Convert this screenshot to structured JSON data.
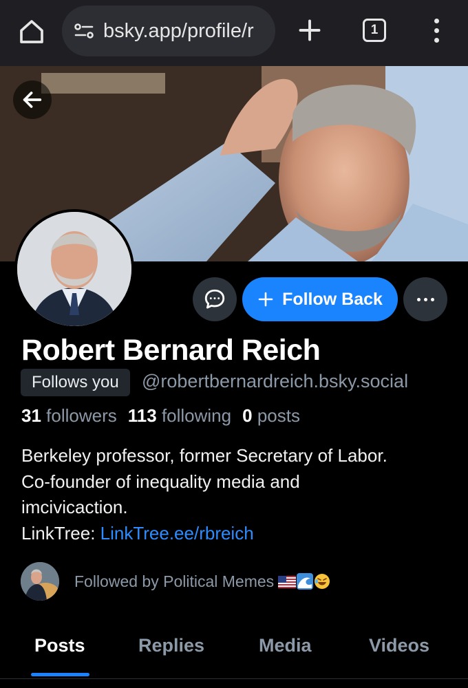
{
  "browser": {
    "url": "bsky.app/profile/r",
    "tab_count": "1",
    "icons": [
      "home-icon",
      "site-settings-icon",
      "plus-icon",
      "tab-switcher-icon",
      "overflow-menu-icon"
    ]
  },
  "profile": {
    "display_name": "Robert Bernard Reich",
    "follows_you": "Follows you",
    "handle": "@robertbernardreich.bsky.social",
    "stats": {
      "followers_count": "31",
      "followers_label": "followers",
      "following_count": "113",
      "following_label": "following",
      "posts_count": "0",
      "posts_label": "posts"
    },
    "bio": {
      "line1": "Berkeley professor, former Secretary of Labor.",
      "line2": "Co-founder of inequality media and",
      "line3": "imcivicaction.",
      "link_prefix": "LinkTree: ",
      "link_text": "LinkTree.ee/rbreich"
    },
    "followed_by": "Followed by Political Memes"
  },
  "actions": {
    "follow_back_label": "Follow Back"
  },
  "tabs": {
    "posts": "Posts",
    "replies": "Replies",
    "media": "Media",
    "videos": "Videos",
    "active": "Posts"
  },
  "colors": {
    "accent": "#1a84ff",
    "link": "#2e8cff",
    "muted_text": "#8c99a8",
    "background": "#000000",
    "chrome": "#1f1f23"
  }
}
